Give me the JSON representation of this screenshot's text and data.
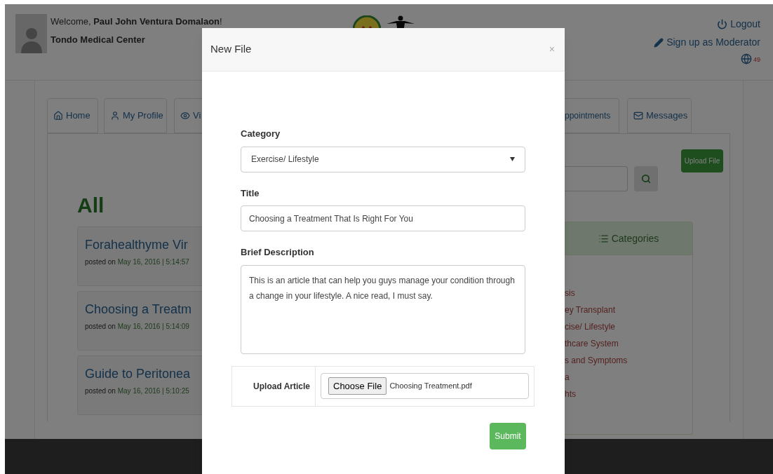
{
  "header": {
    "welcome": "Welcome, **Paul John Ventura Domalaon**!",
    "hospital": "Tondo Medical Center",
    "links": [
      {
        "kind": "logout",
        "label": "Logout"
      },
      {
        "kind": "moderator",
        "label": "Sign up as Moderator"
      }
    ],
    "notification_count": "49"
  },
  "tabs_left": [
    {
      "kind": "home",
      "label": "Home"
    },
    {
      "kind": "profile",
      "label": "My Profile"
    },
    {
      "kind": "view",
      "label": "Vi"
    }
  ],
  "tabs_right": [
    {
      "kind": "appointments",
      "label": "ppointments"
    },
    {
      "kind": "messages",
      "label": "Messages"
    }
  ],
  "section_title": "All",
  "posts": [
    {
      "title": "Forahealthyme Vir",
      "posted": "posted on",
      "date": "May 16, 2016 | 5:14:57"
    },
    {
      "title": "Choosing a Treatm",
      "posted": "posted on",
      "date": "May 16, 2016 | 5:14:09"
    },
    {
      "title": "Guide to Peritonea",
      "posted": "posted on",
      "date": "May 16, 2016 | 5:10:25"
    }
  ],
  "upload_button": "Upload File",
  "categories": {
    "title": "Categories",
    "items": [
      "sis",
      "ey Transplant",
      "cise/ Lifestyle",
      "thcare System",
      "s and Symptoms",
      "a",
      "hts"
    ]
  },
  "modal": {
    "title": "New File",
    "close": "×",
    "fields": [
      {
        "kind": "select",
        "label": "Category",
        "value": "Exercise/ Lifestyle"
      },
      {
        "kind": "text",
        "label": "Title",
        "value": "Choosing a Treatment That Is Right For You"
      },
      {
        "kind": "textarea",
        "label": "Brief Description",
        "value": "This is an article that can help you guys manage your condition through a change in your lifestyle. A nice read, I must say."
      }
    ],
    "upload": {
      "label": "Upload Article",
      "button": "Choose File",
      "file_name": "Choosing Treatment.pdf"
    },
    "submit": "Submit"
  }
}
